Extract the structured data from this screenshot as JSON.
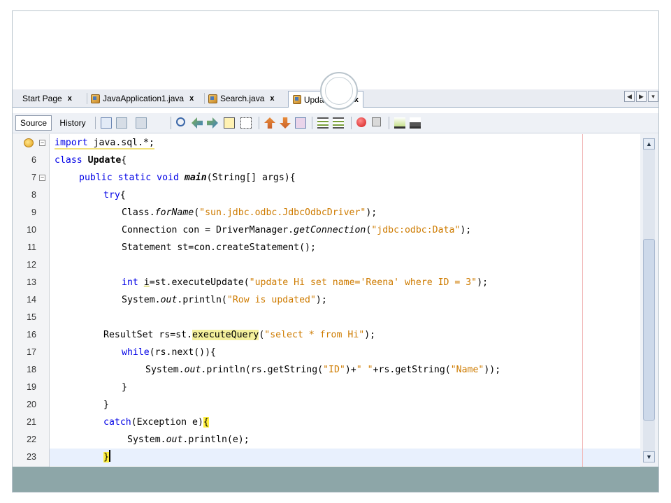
{
  "tabs": [
    {
      "label": "Start Page",
      "close": "x",
      "icon": "none",
      "active": false
    },
    {
      "label": "JavaApplication1.java",
      "close": "x",
      "icon": "java-file-icon",
      "active": false
    },
    {
      "label": "Search.java",
      "close": "x",
      "icon": "java-file-icon",
      "active": false
    },
    {
      "label": "Update.java",
      "close": "x",
      "icon": "java-file-icon",
      "active": true
    }
  ],
  "tab_nav": {
    "prev": "◀",
    "next": "▶",
    "menu": "▾"
  },
  "toolbar": {
    "source_label": "Source",
    "history_label": "History"
  },
  "editor": {
    "lines": [
      {
        "n": "",
        "fold": "−"
      },
      {
        "n": "6",
        "fold": ""
      },
      {
        "n": "7",
        "fold": "−"
      },
      {
        "n": "8",
        "fold": ""
      },
      {
        "n": "9",
        "fold": ""
      },
      {
        "n": "10",
        "fold": ""
      },
      {
        "n": "11",
        "fold": ""
      },
      {
        "n": "12",
        "fold": ""
      },
      {
        "n": "13",
        "fold": ""
      },
      {
        "n": "14",
        "fold": ""
      },
      {
        "n": "15",
        "fold": ""
      },
      {
        "n": "16",
        "fold": ""
      },
      {
        "n": "17",
        "fold": ""
      },
      {
        "n": "18",
        "fold": ""
      },
      {
        "n": "19",
        "fold": ""
      },
      {
        "n": "20",
        "fold": ""
      },
      {
        "n": "21",
        "fold": ""
      },
      {
        "n": "22",
        "fold": ""
      },
      {
        "n": "23",
        "fold": ""
      }
    ],
    "code": {
      "l1_kw": "import",
      "l1_rest": " java.sql.*;",
      "l2_kw": "class",
      "l2_name": "Update",
      "l2_rest": "{",
      "l3_kw": "public static void",
      "l3_name": "main",
      "l3_rest": "(String[] args){",
      "l4_kw": "try",
      "l4_rest": "{",
      "l5_a": "Class.",
      "l5_m": "forName",
      "l5_b": "(",
      "l5_s": "\"sun.jdbc.odbc.JdbcOdbcDriver\"",
      "l5_c": ");",
      "l6_a": "Connection con = DriverManager.",
      "l6_m": "getConnection",
      "l6_b": "(",
      "l6_s": "\"jdbc:odbc:Data\"",
      "l6_c": ");",
      "l7_a": "Statement st=con.createStatement();",
      "l9_kw": "int",
      "l9_v": "i",
      "l9_a": "=st.executeUpdate(",
      "l9_s": "\"update Hi set name='Reena' where ID = 3\"",
      "l9_c": ");",
      "l10_a": "System.",
      "l10_m": "out",
      "l10_b": ".println(",
      "l10_s": "\"Row is updated\"",
      "l10_c": ");",
      "l12_a": "ResultSet rs=st.",
      "l12_h": "executeQuery",
      "l12_b": "(",
      "l12_s": "\"select * from Hi\"",
      "l12_c": ");",
      "l13_kw": "while",
      "l13_a": "(rs.next()){",
      "l14_a": "System.",
      "l14_m": "out",
      "l14_b": ".println(rs.getString(",
      "l14_s1": "\"ID\"",
      "l14_c": ")+",
      "l14_s2": "\" \"",
      "l14_d": "+rs.getString(",
      "l14_s3": "\"Name\"",
      "l14_e": "));",
      "l15_a": "}",
      "l16_a": "}",
      "l17_kw": "catch",
      "l17_a": "(Exception e)",
      "l17_br": "{",
      "l18_a": "System.",
      "l18_m": "out",
      "l18_b": ".println(e);",
      "l19_br": "}"
    }
  },
  "colors": {
    "keyword": "#0000e6",
    "string": "#ce7b00",
    "band": "#8da6a8",
    "brace_match": "#ffef3c",
    "occurrence": "#f4f09c"
  },
  "scrollbar": {
    "up": "▲",
    "down": "▼"
  }
}
